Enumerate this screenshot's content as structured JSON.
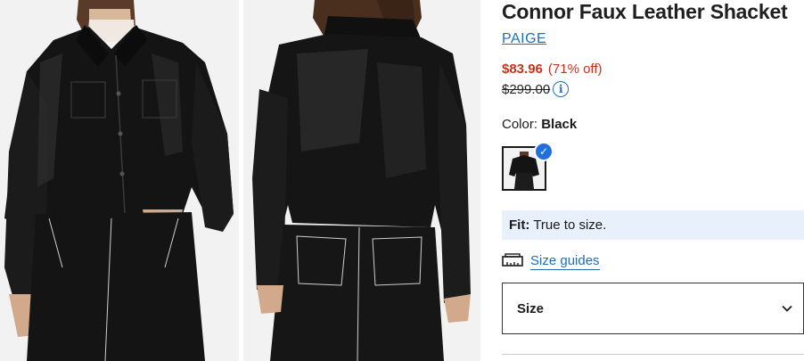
{
  "product": {
    "title": "Connor Faux Leather Shacket",
    "brand": "PAIGE",
    "sale_price": "$83.96",
    "discount": "(71% off)",
    "original_price": "$299.00",
    "info_icon_glyph": "i"
  },
  "color": {
    "label": "Color:",
    "value": "Black",
    "selected_check": "✓"
  },
  "fit": {
    "label": "Fit:",
    "value": "True to size."
  },
  "size_guide": {
    "icon": "ruler-icon",
    "label": "Size guides"
  },
  "size_select": {
    "label": "Size",
    "icon": "chevron-down-icon"
  },
  "images": [
    {
      "name": "product-photo-front",
      "view": "front"
    },
    {
      "name": "product-photo-back",
      "view": "back"
    }
  ],
  "colors": {
    "accent_link": "#1f6fb5",
    "sale_red": "#c8321b",
    "fit_bg": "#e8f1fb",
    "check_blue": "#1f6fde"
  }
}
